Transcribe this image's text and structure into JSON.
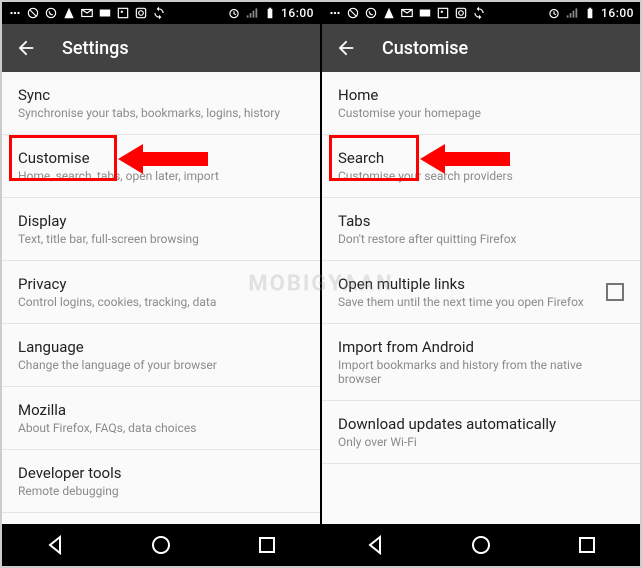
{
  "statusBar": {
    "time": "16:00"
  },
  "left": {
    "title": "Settings",
    "items": [
      {
        "title": "Sync",
        "sub": "Synchronise your tabs, bookmarks, logins, history"
      },
      {
        "title": "Customise",
        "sub": "Home, search, tabs, open later, import"
      },
      {
        "title": "Display",
        "sub": "Text, title bar, full-screen browsing"
      },
      {
        "title": "Privacy",
        "sub": "Control logins, cookies, tracking, data"
      },
      {
        "title": "Language",
        "sub": "Change the language of your browser"
      },
      {
        "title": "Mozilla",
        "sub": "About Firefox, FAQs, data choices"
      },
      {
        "title": "Developer tools",
        "sub": "Remote debugging"
      }
    ]
  },
  "right": {
    "title": "Customise",
    "items": [
      {
        "title": "Home",
        "sub": "Customise your homepage"
      },
      {
        "title": "Search",
        "sub": "Customise your search providers"
      },
      {
        "title": "Tabs",
        "sub": "Don't restore after quitting Firefox"
      },
      {
        "title": "Open multiple links",
        "sub": "Save them until the next time you open Firefox",
        "checkbox": true
      },
      {
        "title": "Import from Android",
        "sub": "Import bookmarks and history from the native browser"
      },
      {
        "title": "Download updates automatically",
        "sub": "Only over Wi-Fi"
      }
    ]
  },
  "watermark": "MOBIGYAAN"
}
